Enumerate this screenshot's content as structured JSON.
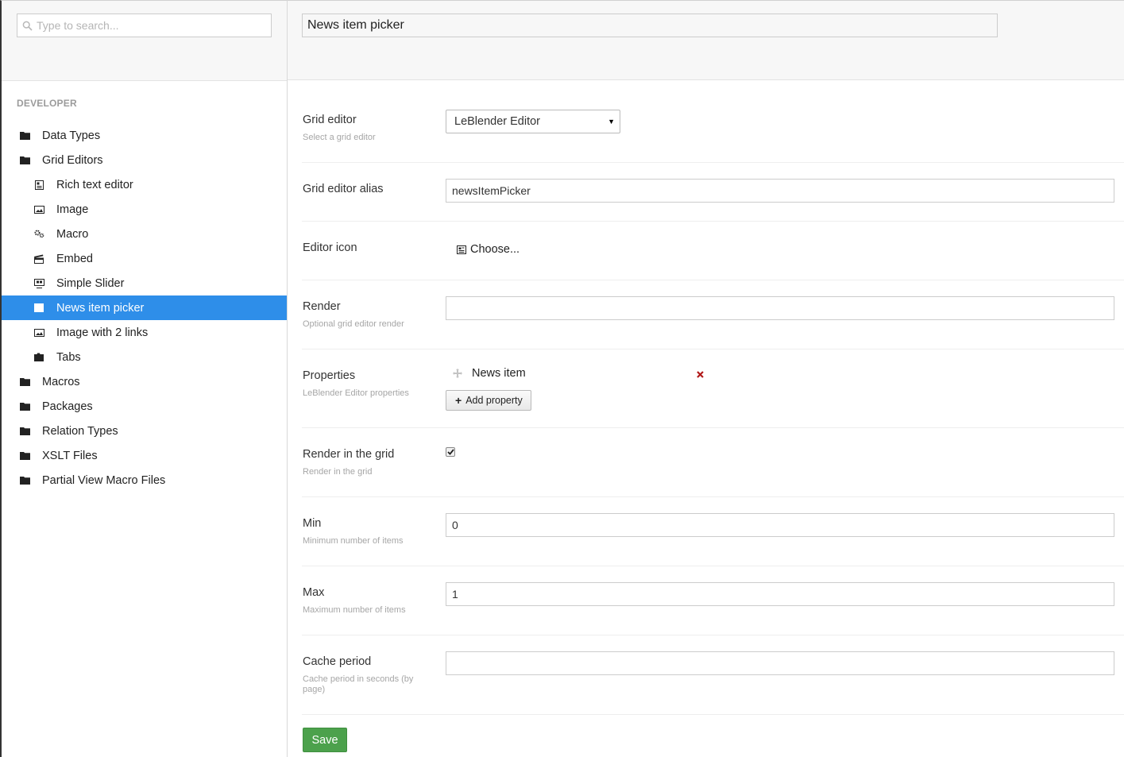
{
  "search": {
    "placeholder": "Type to search..."
  },
  "tree": {
    "section_title": "DEVELOPER",
    "items": [
      {
        "label": "Data Types",
        "icon": "folder-icon",
        "level": 1
      },
      {
        "label": "Grid Editors",
        "icon": "folder-icon",
        "level": 1
      },
      {
        "label": "Rich text editor",
        "icon": "document-icon",
        "level": 2
      },
      {
        "label": "Image",
        "icon": "picture-icon",
        "level": 2
      },
      {
        "label": "Macro",
        "icon": "settings-icon",
        "level": 2
      },
      {
        "label": "Embed",
        "icon": "clapperboard-icon",
        "level": 2
      },
      {
        "label": "Simple Slider",
        "icon": "slideshow-icon",
        "level": 2
      },
      {
        "label": "News item picker",
        "icon": "newspaper-icon",
        "level": 2,
        "active": true
      },
      {
        "label": "Image with 2 links",
        "icon": "picture-icon",
        "level": 2
      },
      {
        "label": "Tabs",
        "icon": "tabs-icon",
        "level": 2
      },
      {
        "label": "Macros",
        "icon": "folder-icon",
        "level": 1
      },
      {
        "label": "Packages",
        "icon": "folder-icon",
        "level": 1
      },
      {
        "label": "Relation Types",
        "icon": "folder-icon",
        "level": 1
      },
      {
        "label": "XSLT Files",
        "icon": "folder-icon",
        "level": 1
      },
      {
        "label": "Partial View Macro Files",
        "icon": "folder-icon",
        "level": 1
      }
    ]
  },
  "editor": {
    "name": "News item picker",
    "grid_editor": {
      "label": "Grid editor",
      "description": "Select a grid editor",
      "value": "LeBlender Editor"
    },
    "alias": {
      "label": "Grid editor alias",
      "value": "newsItemPicker"
    },
    "icon": {
      "label": "Editor icon",
      "choose_label": "Choose..."
    },
    "render": {
      "label": "Render",
      "description": "Optional grid editor render",
      "value": ""
    },
    "properties": {
      "label": "Properties",
      "description": "LeBlender Editor properties",
      "items": [
        "News item"
      ],
      "add_label": "Add property"
    },
    "render_in_grid": {
      "label": "Render in the grid",
      "description": "Render in the grid",
      "checked": true
    },
    "min": {
      "label": "Min",
      "description": "Minimum number of items",
      "value": "0"
    },
    "max": {
      "label": "Max",
      "description": "Maximum number of items",
      "value": "1"
    },
    "cache": {
      "label": "Cache period",
      "description": "Cache period in seconds (by page)",
      "value": ""
    },
    "save_label": "Save"
  },
  "colors": {
    "accent": "#2e8ee9",
    "save": "#4ca14c",
    "remove": "#b11a1a"
  }
}
